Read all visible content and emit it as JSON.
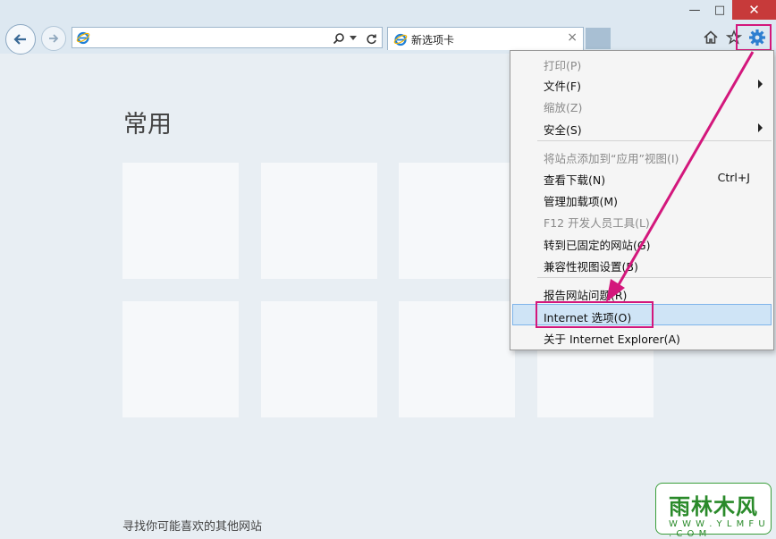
{
  "window": {
    "minimize_glyph": "—",
    "maximize_glyph": "□",
    "close_glyph": "✕"
  },
  "address_bar": {
    "value": "",
    "placeholder": "",
    "icons": [
      "ie-logo-icon",
      "search-icon",
      "dropdown-icon",
      "refresh-icon"
    ]
  },
  "tab": {
    "title": "新选项卡",
    "close_glyph": "×"
  },
  "toolbar": {
    "icons": [
      "home-icon",
      "favorites-star-icon",
      "gear-icon"
    ]
  },
  "page": {
    "heading": "常用",
    "footer_link": "寻找你可能喜欢的其他网站",
    "tiles_row1": 4,
    "tiles_row2": 4
  },
  "menu": {
    "items": [
      {
        "label": "打印(P)",
        "enabled": false
      },
      {
        "label": "文件(F)",
        "enabled": true,
        "submenu": true
      },
      {
        "label": "缩放(Z)",
        "enabled": false
      },
      {
        "label": "安全(S)",
        "enabled": true,
        "submenu": true
      },
      {
        "label": "将站点添加到“应用”视图(I)",
        "enabled": false
      },
      {
        "label": "查看下载(N)",
        "enabled": true,
        "shortcut": "Ctrl+J"
      },
      {
        "label": "管理加载项(M)",
        "enabled": true
      },
      {
        "label": "F12 开发人员工具(L)",
        "enabled": false
      },
      {
        "label": "转到已固定的网站(G)",
        "enabled": true
      },
      {
        "label": "兼容性视图设置(B)",
        "enabled": true
      },
      {
        "label": "报告网站问题(R)",
        "enabled": true
      },
      {
        "label": "Internet 选项(O)",
        "enabled": true,
        "highlighted": true
      },
      {
        "label": "关于 Internet Explorer(A)",
        "enabled": true
      }
    ]
  },
  "annotation": {
    "color": "#d3177c"
  },
  "watermark": {
    "top": "雨林木风",
    "bottom": "W W W . Y L M F U . C O M"
  }
}
